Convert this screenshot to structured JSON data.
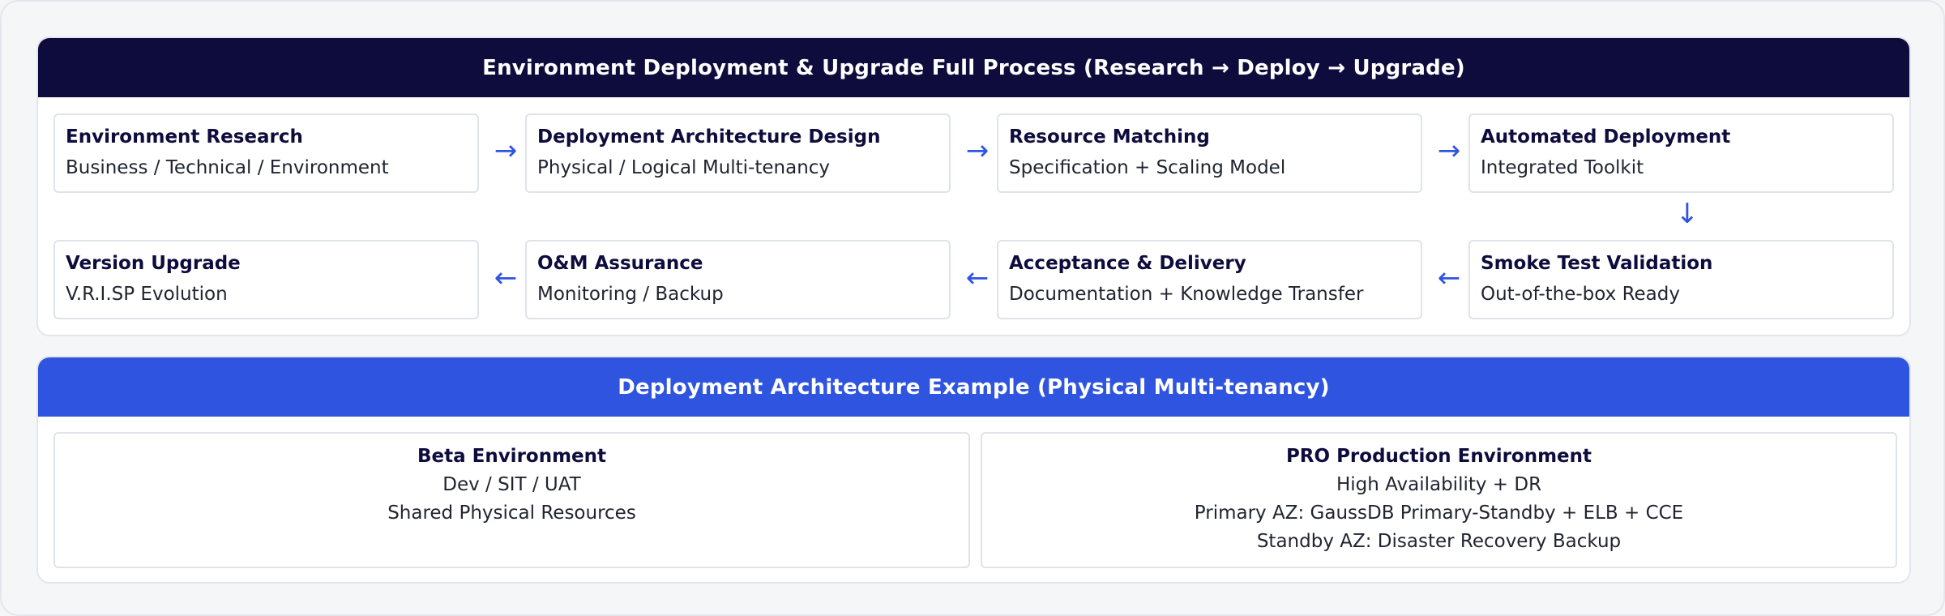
{
  "process": {
    "title": "Environment Deployment & Upgrade Full Process (Research → Deploy → Upgrade)",
    "steps": [
      {
        "title": "Environment Research",
        "subtitle": "Business / Technical / Environment"
      },
      {
        "title": "Deployment Architecture Design",
        "subtitle": "Physical / Logical Multi-tenancy"
      },
      {
        "title": "Resource Matching",
        "subtitle": "Specification + Scaling Model"
      },
      {
        "title": "Automated Deployment",
        "subtitle": "Integrated Toolkit"
      },
      {
        "title": "Smoke Test Validation",
        "subtitle": "Out-of-the-box Ready"
      },
      {
        "title": "Acceptance & Delivery",
        "subtitle": "Documentation + Knowledge Transfer"
      },
      {
        "title": "O&M Assurance",
        "subtitle": "Monitoring / Backup"
      },
      {
        "title": "Version Upgrade",
        "subtitle": "V.R.I.SP Evolution"
      }
    ],
    "arrows": {
      "right": "→",
      "down": "↓",
      "left": "←"
    }
  },
  "architecture": {
    "title": "Deployment Architecture Example (Physical Multi-tenancy)",
    "beta": {
      "title": "Beta Environment",
      "lines": [
        "Dev / SIT / UAT",
        "Shared Physical Resources"
      ]
    },
    "pro": {
      "title": "PRO Production Environment",
      "lines": [
        "High Availability + DR",
        "Primary AZ: GaussDB Primary-Standby + ELB + CCE",
        "Standby AZ: Disaster Recovery Backup"
      ]
    }
  },
  "colors": {
    "header_dark": "#0e0c3d",
    "header_blue": "#2f55e0",
    "arrow": "#2f55e0"
  }
}
